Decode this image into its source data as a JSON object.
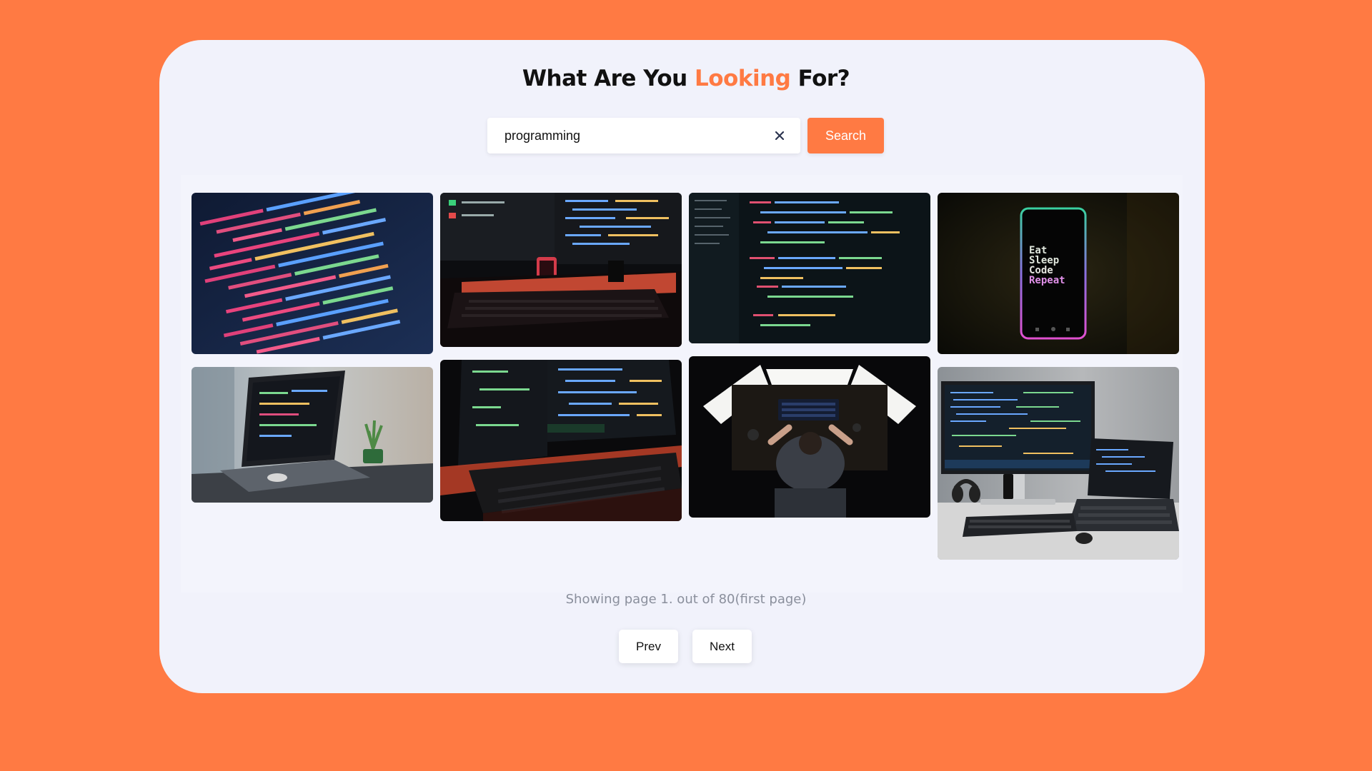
{
  "header": {
    "title_before": "What Are You ",
    "title_accent": "Looking",
    "title_after": " For?"
  },
  "search": {
    "value": "programming",
    "placeholder": "",
    "button_label": "Search",
    "clear_icon": "close-icon"
  },
  "gallery": {
    "images": [
      {
        "name": "image-code-closeup-1",
        "description_visible": false
      },
      {
        "name": "image-monitor-keyboard-red-glow",
        "description_visible": false
      },
      {
        "name": "image-code-editor-dark",
        "description_visible": false
      },
      {
        "name": "image-phone-eat-sleep-code",
        "phone_text": [
          "Eat",
          "Sleep",
          "Code",
          "Repeat"
        ]
      },
      {
        "name": "image-laptop-on-desk",
        "description_visible": false
      },
      {
        "name": "image-monitors-keyboard-red",
        "description_visible": false
      },
      {
        "name": "image-desk-topdown-lights",
        "description_visible": false
      },
      {
        "name": "image-monitor-laptop-setup",
        "description_visible": false
      }
    ]
  },
  "pagination": {
    "status_text": "Showing page 1. out of 80(first page)",
    "prev_label": "Prev",
    "next_label": "Next"
  },
  "colors": {
    "accent": "#ff7a43",
    "card_bg": "#f1f2fb",
    "muted_text": "#8a8f9c"
  }
}
